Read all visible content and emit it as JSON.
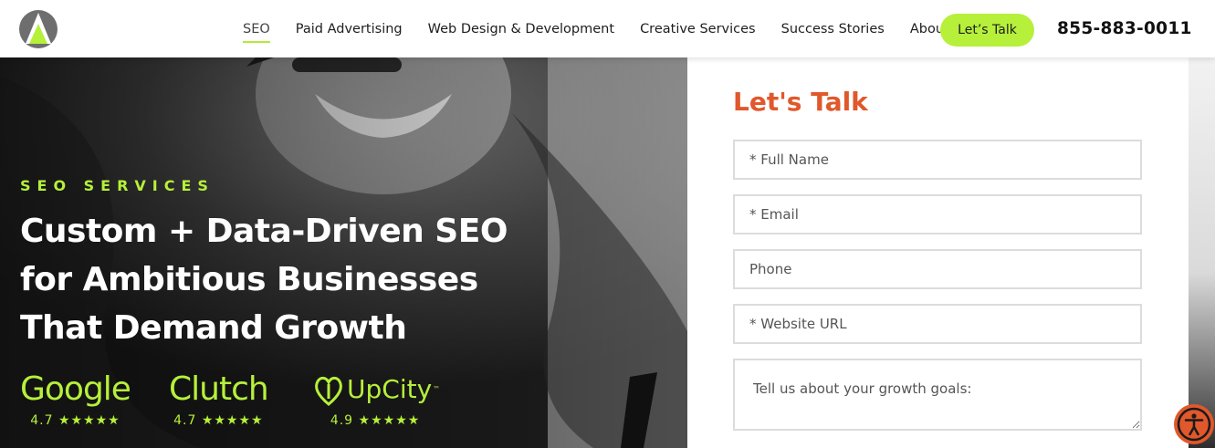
{
  "header": {
    "logo": "arrowhead-logo",
    "nav": [
      {
        "label": "SEO",
        "active": true
      },
      {
        "label": "Paid Advertising"
      },
      {
        "label": "Web Design & Development"
      },
      {
        "label": "Creative Services"
      },
      {
        "label": "Success Stories"
      },
      {
        "label": "About"
      }
    ],
    "cta_label": "Let’s Talk",
    "phone": "855-883-0011"
  },
  "hero": {
    "eyebrow": "SEO SERVICES",
    "headline": [
      "Custom + Data-Driven SEO",
      "for Ambitious Businesses",
      "That Demand Growth"
    ],
    "ratings": [
      {
        "brand": "Google",
        "score": "4.7",
        "stars": "★★★★★",
        "icon": "google-wordmark"
      },
      {
        "brand": "Clutch",
        "score": "4.7",
        "stars": "★★★★★",
        "icon": "clutch-wordmark"
      },
      {
        "brand": "UpCity",
        "tm": "™",
        "score": "4.9",
        "stars": "★★★★★",
        "icon": "upcity-logo"
      }
    ]
  },
  "form": {
    "title": "Let's Talk",
    "full_name_placeholder": "* Full Name",
    "email_placeholder": "* Email",
    "phone_placeholder": "Phone",
    "website_placeholder": "* Website URL",
    "goals_placeholder": "Tell us about your growth goals:"
  },
  "accessibility_icon": "accessibility-icon",
  "colors": {
    "accent_green": "#b6f03a",
    "accent_orange": "#e0582b",
    "text_dark": "#1e1e1e"
  }
}
